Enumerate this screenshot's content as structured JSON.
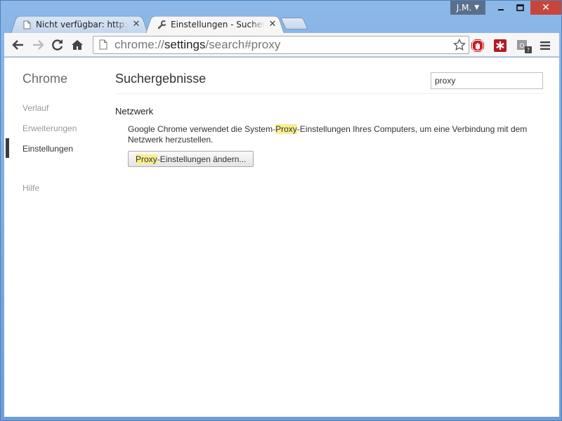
{
  "tabs": [
    {
      "title": "Nicht verfügbar: http://www",
      "active": false,
      "icon": "page-icon"
    },
    {
      "title": "Einstellungen - Suchergebnisse",
      "active": true,
      "icon": "wrench-icon"
    }
  ],
  "profile": {
    "name": "J.M."
  },
  "toolbar": {
    "url_prefix": "chrome://",
    "url_host": "settings",
    "url_path": "/search#proxy"
  },
  "sidebar": {
    "title": "Chrome",
    "items": [
      {
        "label": "Verlauf"
      },
      {
        "label": "Erweiterungen"
      },
      {
        "label": "Einstellungen",
        "selected": true
      },
      {
        "label": "Hilfe"
      }
    ]
  },
  "main": {
    "title": "Suchergebnisse",
    "search_value": "proxy",
    "section_title": "Netzwerk",
    "desc_before": "Google Chrome verwendet die System-",
    "desc_highlight": "Proxy",
    "desc_after": "-Einstellungen Ihres Computers, um eine Verbindung mit dem Netzwerk herzustellen.",
    "button_highlight": "Proxy",
    "button_rest": "-Einstellungen ändern..."
  },
  "colors": {
    "highlight": "#f8ef8f",
    "close_button": "#c7463b",
    "profile_badge": "#5a6f8c"
  }
}
